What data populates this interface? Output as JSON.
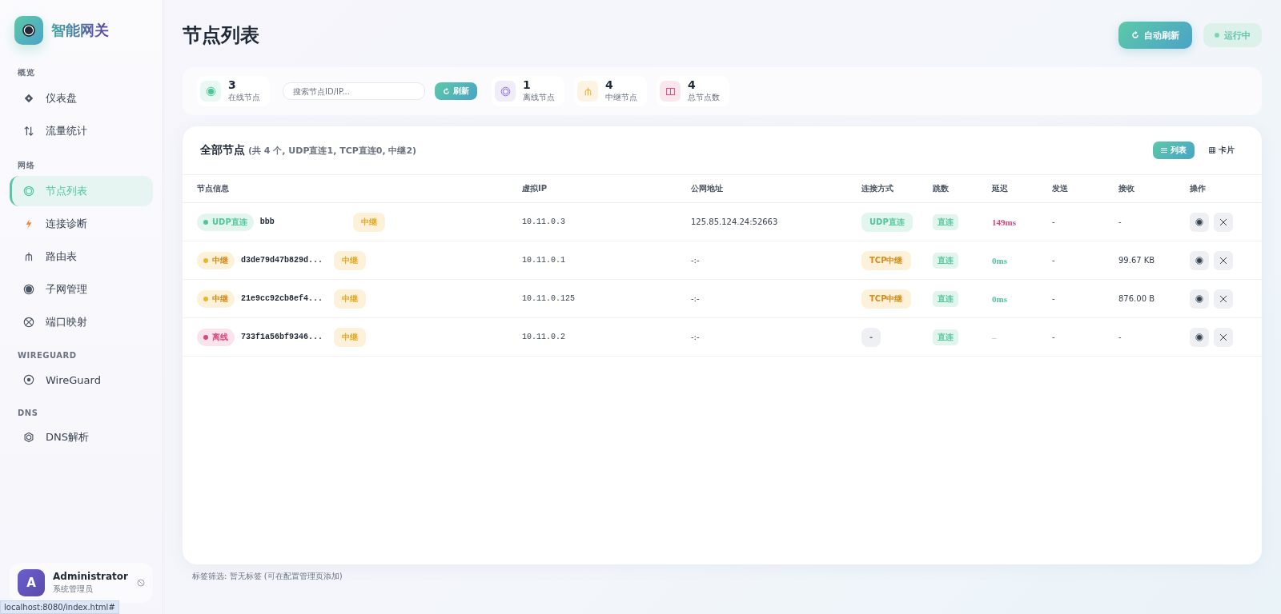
{
  "sidebar": {
    "logo": "智能网关",
    "sections": [
      {
        "title": "概览",
        "items": [
          {
            "label": "仪表盘",
            "selected": false
          },
          {
            "label": "流量统计",
            "selected": false
          }
        ]
      },
      {
        "title": "网络",
        "items": [
          {
            "label": "节点列表",
            "selected": true
          },
          {
            "label": "连接诊断",
            "selected": false
          },
          {
            "label": "路由表",
            "selected": false
          },
          {
            "label": "子网管理",
            "selected": false
          },
          {
            "label": "端口映射",
            "selected": false
          }
        ]
      },
      {
        "title": "WIREGUARD",
        "items": [
          {
            "label": "WireGuard",
            "selected": false
          }
        ]
      },
      {
        "title": "DNS",
        "items": [
          {
            "label": "DNS解析",
            "selected": false
          }
        ]
      }
    ],
    "user": {
      "avatar": "A",
      "name": "Administrator",
      "role": "系统管理员"
    }
  },
  "page_title": "节点列表",
  "header_buttons": {
    "auto_refresh": "自动刷新",
    "status": "运行中"
  },
  "stats": [
    {
      "value": "3",
      "label": "在线节点",
      "color": "#4fc79a"
    },
    {
      "value": "1",
      "label": "离线节点",
      "color": "#8b6fd6"
    },
    {
      "value": "4",
      "label": "中继节点",
      "color": "#e9a825"
    },
    {
      "value": "4",
      "label": "总节点数",
      "color": "#d9487e"
    }
  ],
  "search": {
    "placeholder": "搜索节点ID/IP..."
  },
  "refresh_button": "刷新",
  "table": {
    "title": "全部节点",
    "summary": "(共 4 个, UDP直连1, TCP直连0, 中继2)",
    "views": [
      {
        "label": "列表",
        "selected": true
      },
      {
        "label": "卡片",
        "selected": false
      }
    ],
    "columns": [
      "节点信息",
      "虚拟IP",
      "公网地址",
      "连接方式",
      "跳数",
      "延迟",
      "发送",
      "接收",
      "操作"
    ],
    "rows": [
      {
        "status": {
          "label": "UDP直连",
          "kind": "direct"
        },
        "name": "bbb",
        "tag": "中继",
        "virtual_ip": "10.11.0.3",
        "public_address": "125.85.124.24:52663",
        "connection": {
          "label": "UDP直连",
          "kind": "direct"
        },
        "hops": "直连",
        "latency": {
          "label": "149ms",
          "kind": "slow"
        },
        "sent": "-",
        "received": "-"
      },
      {
        "status": {
          "label": "中继",
          "kind": "relay"
        },
        "name": "d3de79d47b829d...",
        "tag": "中继",
        "virtual_ip": "10.11.0.1",
        "public_address": "-:-",
        "connection": {
          "label": "TCP中继",
          "kind": "relay"
        },
        "hops": "直连",
        "latency": {
          "label": "0ms",
          "kind": "fast"
        },
        "sent": "-",
        "received": "99.67 KB"
      },
      {
        "status": {
          "label": "中继",
          "kind": "relay"
        },
        "name": "21e9cc92cb8ef4...",
        "tag": "中继",
        "virtual_ip": "10.11.0.125",
        "public_address": "-:-",
        "connection": {
          "label": "TCP中继",
          "kind": "relay"
        },
        "hops": "直连",
        "latency": {
          "label": "0ms",
          "kind": "fast"
        },
        "sent": "-",
        "received": "876.00 B"
      },
      {
        "status": {
          "label": "离线",
          "kind": "offline"
        },
        "name": "733f1a56bf9346...",
        "tag": "中继",
        "virtual_ip": "10.11.0.2",
        "public_address": "-:-",
        "connection": {
          "label": "-",
          "kind": "none"
        },
        "hops": "直连",
        "latency": {
          "label": "–",
          "kind": "none"
        },
        "sent": "-",
        "received": "-"
      }
    ]
  },
  "tag_filter": "标签筛选:  暂无标签 (可在配置管理页添加)",
  "status_bar": "localhost:8080/index.html#"
}
